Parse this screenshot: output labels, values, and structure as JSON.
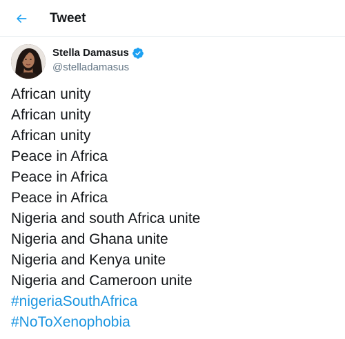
{
  "header": {
    "back_icon": "arrow-left-icon",
    "title": "Tweet"
  },
  "tweet": {
    "author": {
      "display_name": "Stella Damasus",
      "handle": "@stelladamasus",
      "verified": true,
      "verified_icon": "verified-badge-icon"
    },
    "lines": [
      "African unity",
      "African unity",
      "African unity",
      "Peace in Africa",
      "Peace in Africa",
      "Peace in Africa",
      "Nigeria and south Africa unite",
      "Nigeria and Ghana unite",
      "Nigeria and Kenya unite",
      "Nigeria and Cameroon unite"
    ],
    "hashtags": [
      "#nigeriaSouthAfrica",
      "#NoToXenophobia"
    ]
  },
  "colors": {
    "accent": "#1da1f2",
    "hashtag": "#1b95e0",
    "text": "#14171a",
    "secondary_text": "#657786",
    "divider": "#e6ecf0"
  }
}
